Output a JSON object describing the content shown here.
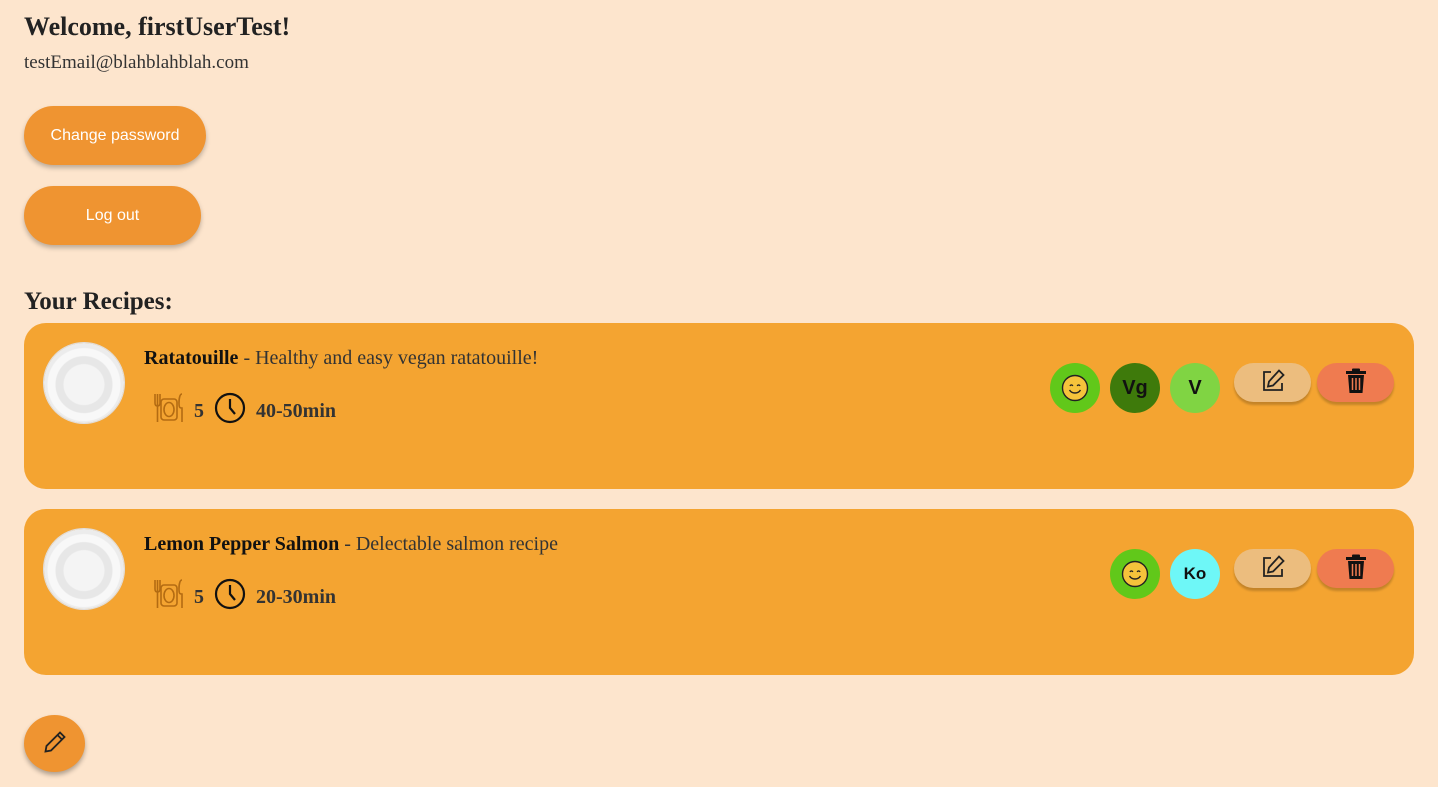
{
  "profile": {
    "welcome": "Welcome, firstUserTest!",
    "email": "testEmail@blahblahblah.com",
    "change_password_label": "Change password",
    "logout_label": "Log out"
  },
  "recipes_heading": "Your Recipes:",
  "recipes": [
    {
      "name": "Ratatouille",
      "description": " - Healthy and easy vegan ratatouille!",
      "servings": "5",
      "time": "40-50min",
      "tags": [
        {
          "label": "",
          "icon": "smiley-icon",
          "color": "#61c81a"
        },
        {
          "label": "Vg",
          "icon": "",
          "color": "#3e7a0b"
        },
        {
          "label": "V",
          "icon": "",
          "color": "#80d443"
        }
      ]
    },
    {
      "name": "Lemon Pepper Salmon",
      "description": " - Delectable salmon recipe",
      "servings": "5",
      "time": "20-30min",
      "tags": [
        {
          "label": "",
          "icon": "smiley-icon",
          "color": "#61c81a"
        },
        {
          "label": "Ko",
          "icon": "",
          "color": "#6ef7f7"
        }
      ]
    }
  ],
  "colors": {
    "background": "#fde5cd",
    "card": "#f4a431",
    "button": "#ef9431",
    "edit_button": "#ecbd7e",
    "delete_button": "#ef7b50"
  },
  "icons": {
    "servings": "plate-cutlery-icon",
    "time": "clock-icon",
    "edit": "edit-icon",
    "delete": "trash-icon",
    "fab": "pencil-icon"
  }
}
